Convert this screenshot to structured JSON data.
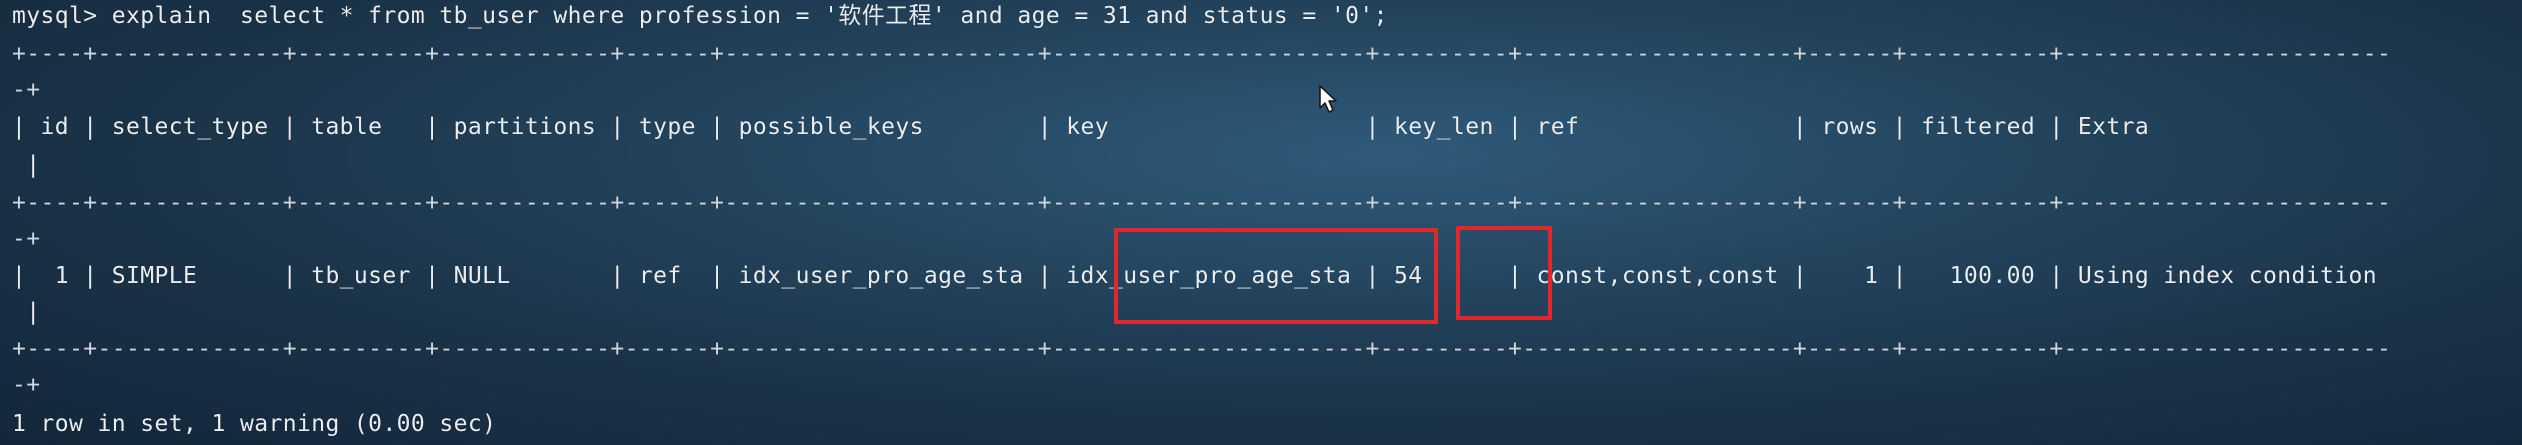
{
  "terminal": {
    "command": "mysql> explain  select * from tb_user where profession = '软件工程' and age = 31 and status = '0';",
    "separator_a": "+----+-------------+---------+------------+------+----------------------+----------------------+---------+-------------------+------+----------+-----------------------",
    "separator_b": "-+",
    "header": "| id | select_type | table   | partitions | type | possible_keys        | key                  | key_len | ref               | rows | filtered | Extra",
    "header_tail": " |",
    "row": "|  1 | SIMPLE      | tb_user | NULL       | ref  | idx_user_pro_age_sta | idx_user_pro_age_sta | 54      | const,const,const |    1 |   100.00 | Using index condition",
    "row_tail": " |",
    "footer": "1 row in set, 1 warning (0.00 sec)"
  },
  "highlights": {
    "key_value": "idx_user_pro_age_sta",
    "key_len_value": "54"
  }
}
